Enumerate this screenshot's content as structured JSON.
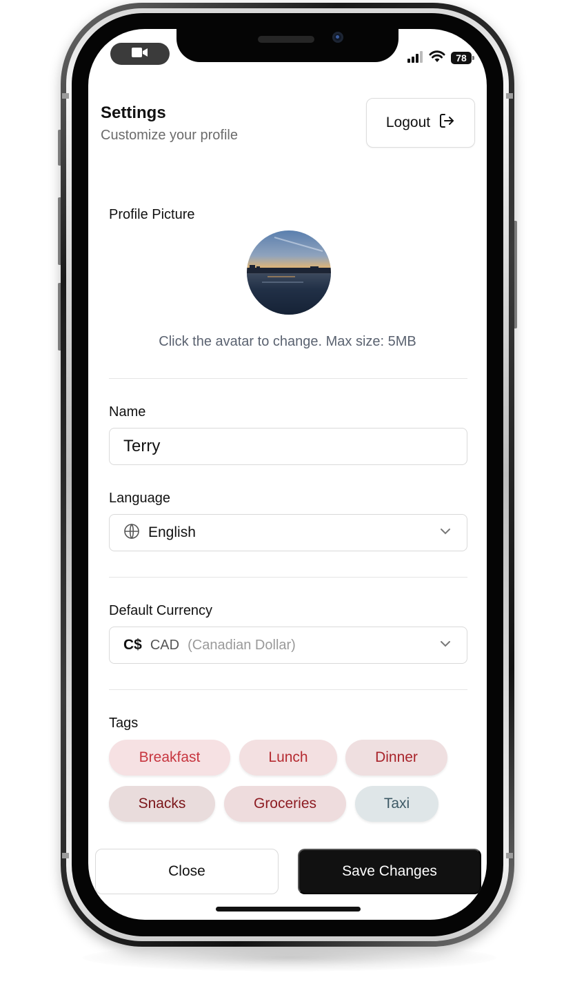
{
  "status_bar": {
    "battery": "78",
    "icons": [
      "video-camera-icon",
      "cellular-signal-icon",
      "wifi-icon",
      "battery-icon"
    ]
  },
  "header": {
    "title": "Settings",
    "subtitle": "Customize your profile",
    "logout_label": "Logout",
    "logout_icon": "logout-icon"
  },
  "profile": {
    "label": "Profile Picture",
    "hint": "Click the avatar to change. Max size: 5MB"
  },
  "name": {
    "label": "Name",
    "value": "Terry"
  },
  "language": {
    "label": "Language",
    "value": "English",
    "icon": "globe-icon"
  },
  "currency": {
    "label": "Default Currency",
    "symbol": "C$",
    "code": "CAD",
    "name": "(Canadian Dollar)"
  },
  "tags": {
    "label": "Tags",
    "items": [
      {
        "label": "Breakfast",
        "color": "#c7353f",
        "bg": "#f6e1e3"
      },
      {
        "label": "Lunch",
        "color": "#b52b31",
        "bg": "#f3e0e1"
      },
      {
        "label": "Dinner",
        "color": "#a8232a",
        "bg": "#efdfe0"
      },
      {
        "label": "Snacks",
        "color": "#7a1418",
        "bg": "#e9dcdc"
      },
      {
        "label": "Groceries",
        "color": "#8d1c22",
        "bg": "#eedcdd"
      },
      {
        "label": "Taxi",
        "color": "#3d5965",
        "bg": "#dfe6e8"
      }
    ]
  },
  "footer": {
    "close_label": "Close",
    "save_label": "Save Changes"
  }
}
